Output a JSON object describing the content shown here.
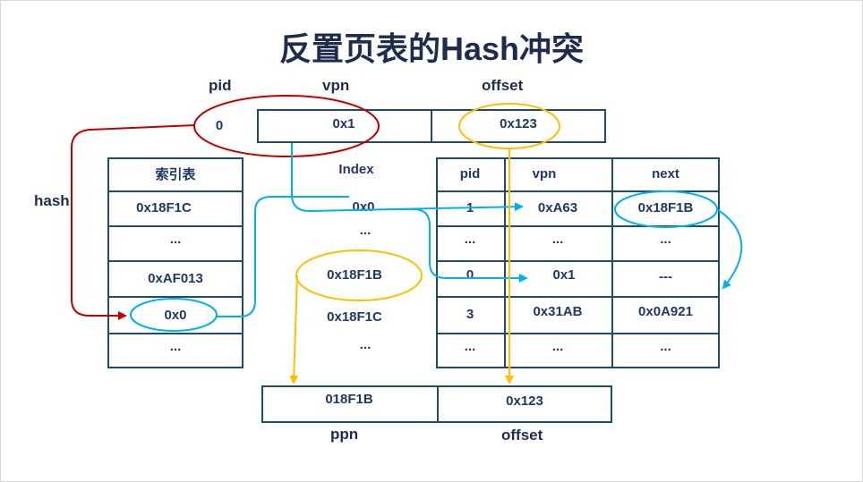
{
  "title": "反置页表的Hash冲突",
  "virtual_address": {
    "header_pid": "pid",
    "header_vpn": "vpn",
    "header_offset": "offset",
    "pid": "0",
    "vpn": "0x1",
    "offset": "0x123"
  },
  "hash_label": "hash",
  "index_table": {
    "header": "索引表",
    "rows": [
      "0x18F1C",
      "...",
      "0xAF013",
      "0x0",
      "..."
    ]
  },
  "index_column": {
    "header": "Index",
    "rows": [
      "0x0",
      "...",
      "0x18F1B",
      "0x18F1C",
      "..."
    ]
  },
  "page_table": {
    "headers": [
      "pid",
      "vpn",
      "next"
    ],
    "rows": [
      [
        "1",
        "0xA63",
        "0x18F1B"
      ],
      [
        "...",
        "...",
        "..."
      ],
      [
        "0",
        "0x1",
        "---"
      ],
      [
        "3",
        "0x31AB",
        "0x0A921"
      ],
      [
        "...",
        "...",
        "..."
      ]
    ]
  },
  "physical_address": {
    "ppn": "018F1B",
    "offset": "0x123",
    "label_ppn": "ppn",
    "label_offset": "offset"
  },
  "colors": {
    "hash_red": "#c00000",
    "index_blue": "#00b0f0",
    "offset_yellow": "#ffc000",
    "table_border": "#1f4e64"
  }
}
